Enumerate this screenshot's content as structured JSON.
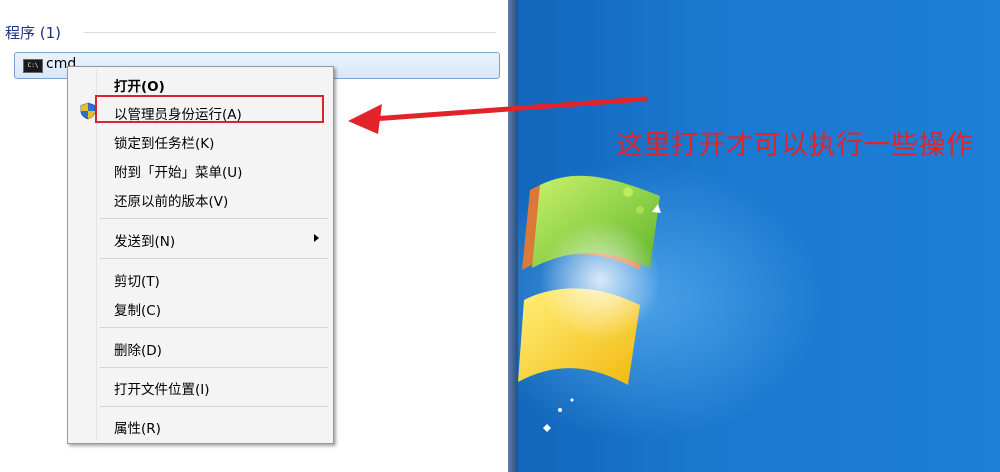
{
  "start_menu": {
    "section_header": "程序 (1)",
    "result": {
      "label": "cmd",
      "icon": "cmd-icon"
    }
  },
  "context_menu": {
    "items": [
      {
        "label": "打开(O)",
        "bold": true
      },
      {
        "label": "以管理员身份运行(A)",
        "icon": "uac-shield-icon",
        "highlighted": true
      },
      {
        "label": "锁定到任务栏(K)"
      },
      {
        "label": "附到「开始」菜单(U)"
      },
      {
        "label": "还原以前的版本(V)"
      },
      {
        "label": "发送到(N)",
        "submenu": true
      },
      {
        "label": "剪切(T)"
      },
      {
        "label": "复制(C)"
      },
      {
        "label": "删除(D)"
      },
      {
        "label": "打开文件位置(I)"
      },
      {
        "label": "属性(R)"
      }
    ]
  },
  "annotation": {
    "text": "这里打开才可以执行一些操作",
    "color": "#e2232a"
  },
  "colors": {
    "desktop": "#1565b8",
    "highlight_border": "#d9262e",
    "header_text": "#1e3287"
  }
}
